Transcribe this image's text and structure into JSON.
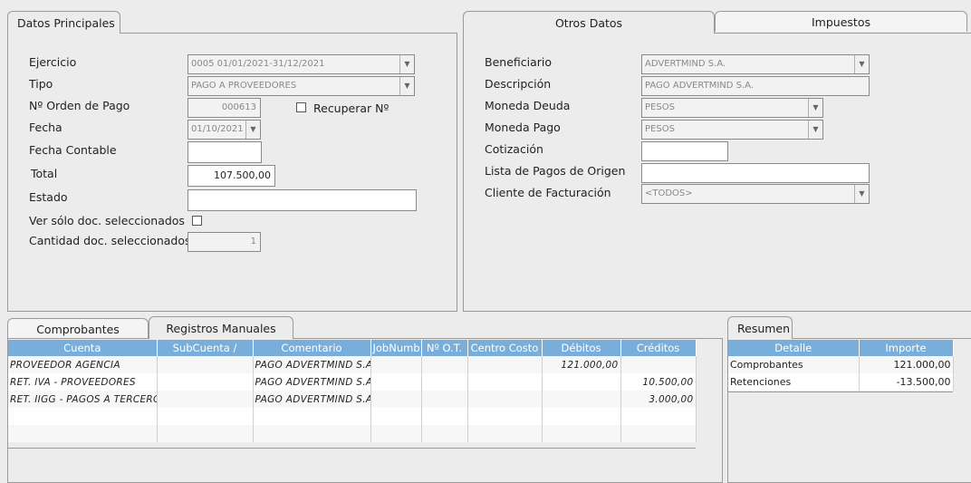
{
  "tabs_top_left": [
    {
      "label": "Datos Principales",
      "active": true
    }
  ],
  "tabs_top_right": [
    {
      "label": "Otros Datos",
      "active": true
    },
    {
      "label": "Impuestos",
      "active": false
    }
  ],
  "main": {
    "ejercicio": {
      "label": "Ejercicio",
      "value": "0005 01/01/2021-31/12/2021"
    },
    "tipo": {
      "label": "Tipo",
      "value": "PAGO A PROVEEDORES"
    },
    "orden": {
      "label": "Nº Orden de Pago",
      "value": "000613"
    },
    "recuperar": {
      "label": "Recuperar Nº"
    },
    "fecha": {
      "label": "Fecha",
      "value": "01/10/2021"
    },
    "fecha_contable": {
      "label": "Fecha Contable",
      "value": ""
    },
    "total": {
      "label": "Total",
      "value": "107.500,00"
    },
    "estado": {
      "label": "Estado",
      "value": ""
    },
    "ver_solo": {
      "label": "Ver sólo doc. seleccionados"
    },
    "cantidad": {
      "label": "Cantidad doc. seleccionados",
      "value": "1"
    }
  },
  "otros": {
    "beneficiario": {
      "label": "Beneficiario",
      "value": "ADVERTMIND S.A."
    },
    "descripcion": {
      "label": "Descripción",
      "value": "PAGO ADVERTMIND S.A."
    },
    "moneda_deuda": {
      "label": "Moneda Deuda",
      "value": "PESOS"
    },
    "moneda_pago": {
      "label": "Moneda Pago",
      "value": "PESOS"
    },
    "cotizacion": {
      "label": "Cotización",
      "value": ""
    },
    "lista_pagos": {
      "label": "Lista de Pagos de Origen",
      "value": ""
    },
    "cliente": {
      "label": "Cliente de Facturación",
      "value": "<TODOS>"
    }
  },
  "tabs_bottom_left": [
    {
      "label": "Comprobantes",
      "active": false
    },
    {
      "label": "Registros Manuales",
      "active": true
    }
  ],
  "registros": {
    "columns": [
      "Cuenta",
      "SubCuenta /",
      "Comentario",
      "JobNumb",
      "Nº O.T.",
      "Centro Costo",
      "Débitos",
      "Créditos"
    ],
    "rows": [
      [
        "PROVEEDOR AGENCIA",
        "",
        "PAGO ADVERTMIND S.A.",
        "",
        "",
        "",
        "121.000,00",
        ""
      ],
      [
        "RET. IVA - PROVEEDORES",
        "",
        "PAGO ADVERTMIND S.A.",
        "",
        "",
        "",
        "",
        "10.500,00"
      ],
      [
        "RET. IIGG - PAGOS A TERCEROS",
        "",
        "PAGO ADVERTMIND S.A.",
        "",
        "",
        "",
        "",
        "3.000,00"
      ],
      [
        "",
        "",
        "",
        "",
        "",
        "",
        "",
        ""
      ],
      [
        "",
        "",
        "",
        "",
        "",
        "",
        "",
        ""
      ]
    ]
  },
  "tabs_bottom_right": [
    {
      "label": "Resumen",
      "active": true
    }
  ],
  "resumen": {
    "columns": [
      "Detalle",
      "Importe"
    ],
    "rows": [
      [
        "Comprobantes",
        "121.000,00"
      ],
      [
        "Retenciones",
        "-13.500,00"
      ]
    ]
  }
}
